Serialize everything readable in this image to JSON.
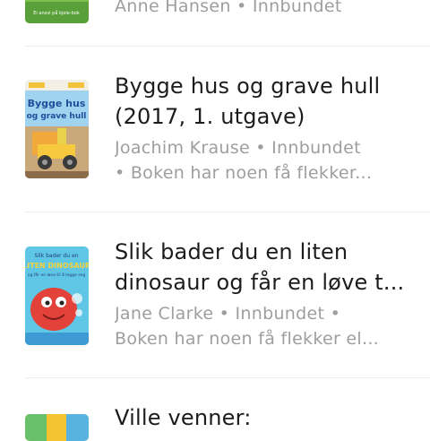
{
  "books": [
    {
      "title_lines": [],
      "meta_lines": [
        "Anne Hansen • Innbundet"
      ],
      "cover_text": [
        "Ei ansvi på kjole-bok"
      ]
    },
    {
      "title_lines": [
        "Bygge hus og grave hull",
        "(2017, 1. utgave)"
      ],
      "meta_lines": [
        "Joachim Krause • Innbundet",
        "• Boken har noen få flekker..."
      ],
      "cover_text": [
        "Bygge hus",
        "og grave hull"
      ]
    },
    {
      "title_lines": [
        "Slik bader du en liten",
        "dinosaur og får en løve t..."
      ],
      "meta_lines": [
        "Jane Clarke • Innbundet •",
        "Boken har noen få flekker el..."
      ],
      "cover_text": [
        "Slik bader du en",
        "LITEN DINOSAUR",
        "og får en løve til å legge seg"
      ]
    },
    {
      "title_lines": [
        "Ville venner:"
      ],
      "meta_lines": [],
      "cover_text": []
    }
  ],
  "colors": {
    "divider": "#ececec",
    "title": "#1c1c1c",
    "meta": "#9e9e9e"
  }
}
